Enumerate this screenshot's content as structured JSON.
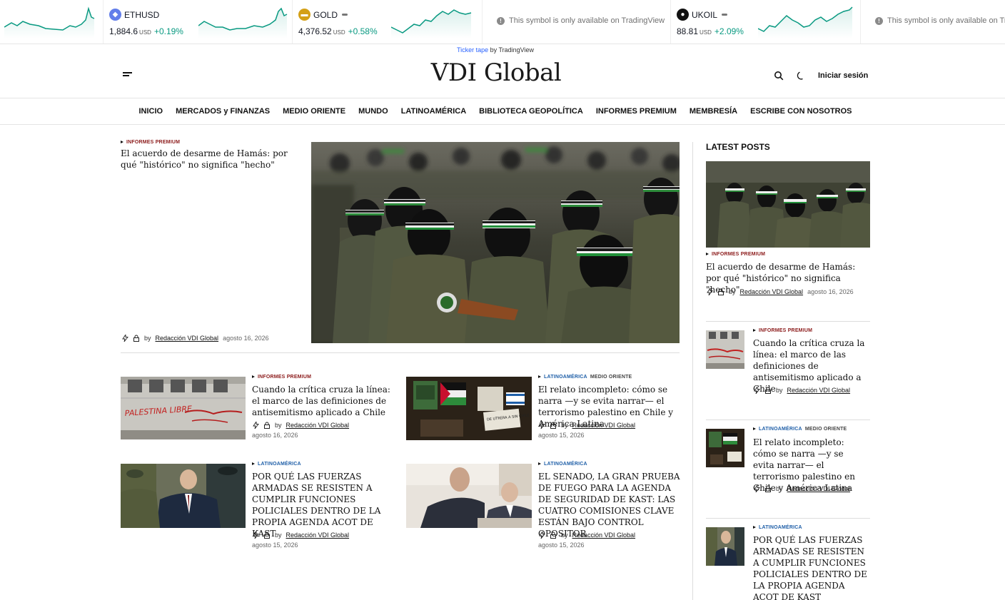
{
  "ticker": {
    "ethusd": {
      "symbol": "ETHUSD",
      "value": "1,884.6",
      "currency": "USD",
      "change": "+0.19%"
    },
    "gold": {
      "symbol": "GOLD",
      "value": "4,376.52",
      "currency": "USD",
      "change": "+0.58%"
    },
    "unavailable_1": "This symbol is only available on TradingView",
    "ukoil": {
      "symbol": "UKOIL",
      "value": "88.81",
      "currency": "USD",
      "change": "+2.09%"
    },
    "unavailable_2": "This symbol is only available on TradingView",
    "credit_link": "Ticker tape",
    "credit_rest": " by TradingView"
  },
  "colors": {
    "up": "#089981",
    "premium": "#8b1a1a",
    "latam": "#1f5fa8"
  },
  "header": {
    "logo": "VDI Global",
    "login": "Iniciar sesión",
    "icons": [
      "menu-icon",
      "search-icon",
      "moon-icon"
    ]
  },
  "nav": [
    "INICIO",
    "MERCADOS y FINANZAS",
    "MEDIO ORIENTE",
    "MUNDO",
    "LATINOAMÉRICA",
    "BIBLIOTECA GEOPOLÍTICA",
    "INFORMES PREMIUM",
    "MEMBRESÍA",
    "ESCRIBE CON NOSOTROS"
  ],
  "common": {
    "by": "by",
    "author": "Redacción VDI Global"
  },
  "featured": {
    "category": "INFORMES PREMIUM",
    "title": "El acuerdo de desarme de Hamás: por qué \"histórico\" no significa \"hecho\"",
    "date": "agosto 16, 2026"
  },
  "grid": [
    {
      "cat1": "INFORMES PREMIUM",
      "cat2": "",
      "title": "Cuando la crítica cruza la línea: el marco de las definiciones de antisemitismo aplicado a Chile",
      "date": "agosto 16, 2026"
    },
    {
      "cat1": "LATINOAMÉRICA",
      "cat2": "MEDIO ORIENTE",
      "title": "El relato incompleto: cómo se narra —y se evita narrar— el terrorismo palestino en Chile y América Latina",
      "date": "agosto 15, 2026"
    },
    {
      "cat1": "LATINOAMÉRICA",
      "cat2": "",
      "title": "POR QUÉ LAS FUERZAS ARMADAS SE RESISTEN A CUMPLIR FUNCIONES POLICIALES DENTRO DE LA PROPIA AGENDA ACOT DE KAST",
      "date": "agosto 15, 2026"
    },
    {
      "cat1": "LATINOAMÉRICA",
      "cat2": "",
      "title": "EL SENADO, LA GRAN PRUEBA DE FUEGO PARA LA AGENDA DE SEGURIDAD DE KAST: LAS CUATRO COMISIONES CLAVE ESTÁN BAJO CONTROL OPOSITOR",
      "date": "agosto 15, 2026"
    }
  ],
  "sidebar": {
    "heading": "LATEST POSTS",
    "items": [
      {
        "cat1": "INFORMES PREMIUM",
        "cat2": "",
        "title": "El acuerdo de desarme de Hamás: por qué \"histórico\" no significa \"hecho\"",
        "date": "agosto 16, 2026"
      },
      {
        "cat1": "INFORMES PREMIUM",
        "cat2": "",
        "title": "Cuando la crítica cruza la línea: el marco de las definiciones de antisemitismo aplicado a Chile"
      },
      {
        "cat1": "LATINOAMÉRICA",
        "cat2": "MEDIO ORIENTE",
        "title": "El relato incompleto: cómo se narra —y se evita narrar— el terrorismo palestino en Chile y América Latina"
      },
      {
        "cat1": "LATINOAMÉRICA",
        "cat2": "",
        "title": "POR QUÉ LAS FUERZAS ARMADAS SE RESISTEN A CUMPLIR FUNCIONES POLICIALES DENTRO DE LA PROPIA AGENDA ACOT DE KAST"
      }
    ]
  },
  "images": {
    "graffiti_text": "PALESTINA LIBRE",
    "sign_text": "DE UTRERA A SIN CHILE"
  }
}
